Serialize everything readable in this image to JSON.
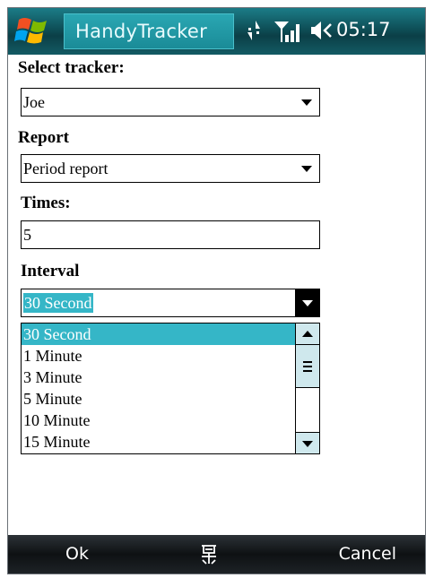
{
  "titlebar": {
    "app_title": "HandyTracker",
    "time": "05:17",
    "icons": [
      "windows-start-icon",
      "connectivity-icon",
      "signal-strength-icon",
      "volume-icon"
    ]
  },
  "form": {
    "tracker_label": "Select tracker:",
    "tracker_value": "Joe",
    "report_label": "Report",
    "report_value": "Period report",
    "times_label": "Times:",
    "times_value": "5",
    "interval_label": "Interval",
    "interval_value": "30 Second",
    "interval_options": [
      "30 Second",
      "1 Minute",
      "3 Minute",
      "5 Minute",
      "10 Minute",
      "15 Minute"
    ]
  },
  "softkeys": {
    "left": "Ok",
    "right": "Cancel",
    "center_icon": "keyboard-icon"
  },
  "colors": {
    "title_bar": "#0e4f57",
    "title_highlight": "#2aa7b3",
    "selection": "#35b6c7",
    "softkey_bar": "#0e1113"
  }
}
